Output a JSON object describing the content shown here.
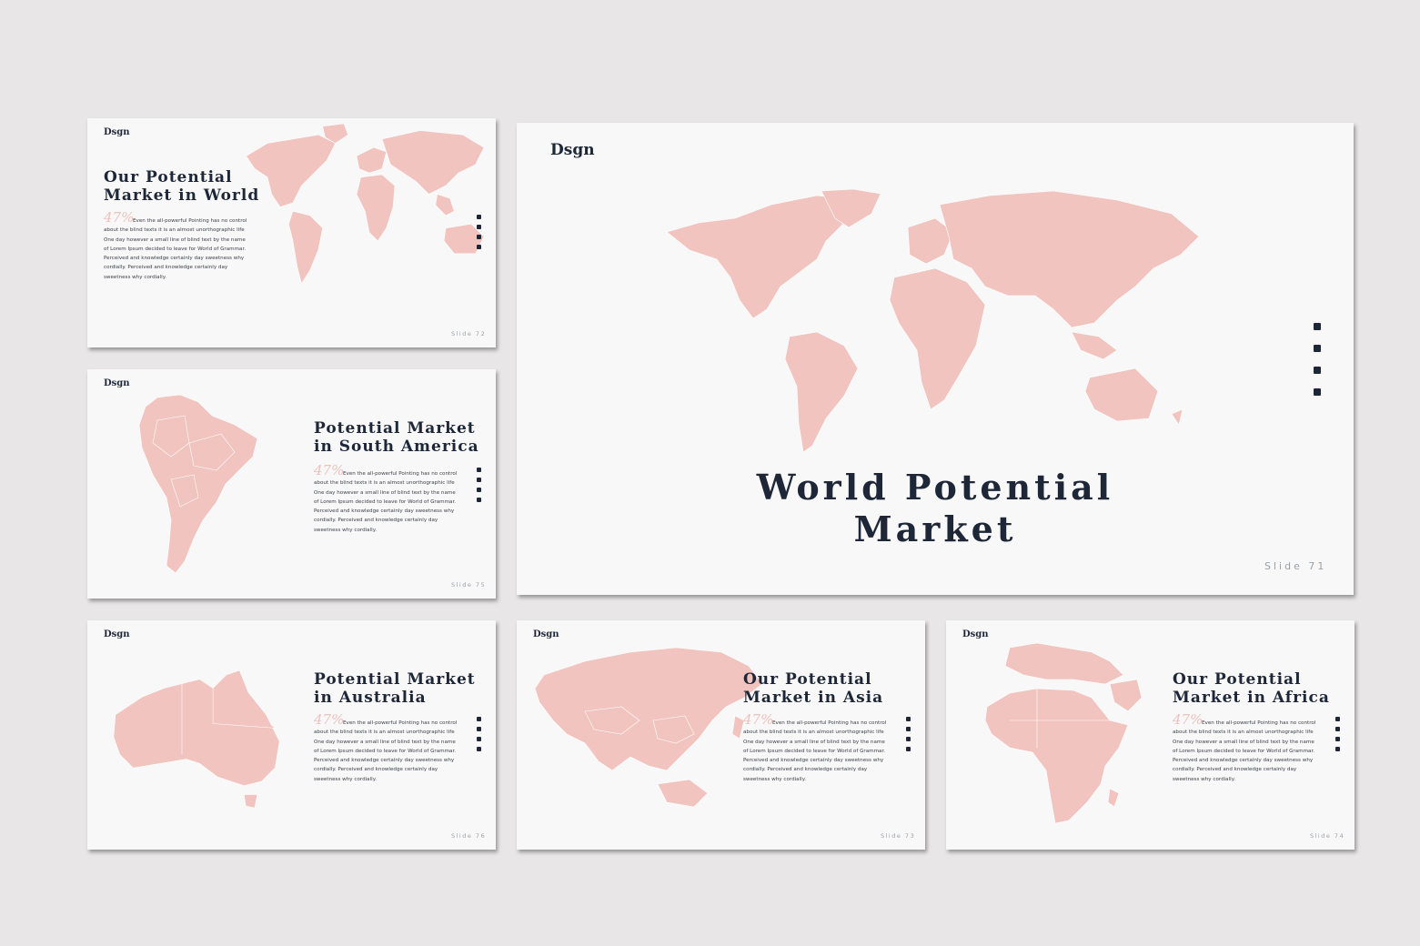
{
  "logo": "Dsgn",
  "body_text_lines": [
    "Even the all-powerful Pointing has no control",
    "about the blind texts it is an almost unorthographic life",
    "One day however a small line of blind text by the name",
    "of Lorem Ipsum decided to leave for World of Grammar.",
    "Perceived and knowledge certainly day sweetness why",
    "cordially. Perceived and knowledge certainly day",
    "sweetness why cordially."
  ],
  "percent": "47%",
  "slides": {
    "s72": {
      "title_line1": "Our Potential",
      "title_line2": "Market in World",
      "slide_num": "Slide 72"
    },
    "s75": {
      "title_line1": "Potential Market",
      "title_line2": "in South America",
      "slide_num": "Slide 75"
    },
    "s71": {
      "title_line1": "World Potential",
      "title_line2": "Market",
      "slide_num": "Slide 71"
    },
    "s76": {
      "title_line1": "Potential Market",
      "title_line2": "in Australia",
      "slide_num": "Slide 76"
    },
    "s73": {
      "title_line1": "Our Potential",
      "title_line2": "Market in Asia",
      "slide_num": "Slide 73"
    },
    "s74": {
      "title_line1": "Our Potential",
      "title_line2": "Market in Africa",
      "slide_num": "Slide 74"
    }
  },
  "social_icons": [
    "twitter-icon",
    "instagram-icon",
    "youtube-icon",
    "behance-icon"
  ],
  "colors": {
    "map": "#f1c4c0",
    "text_dark": "#1d2738",
    "accent_percent": "#f0c0bb",
    "background": "#e8e6e7"
  }
}
